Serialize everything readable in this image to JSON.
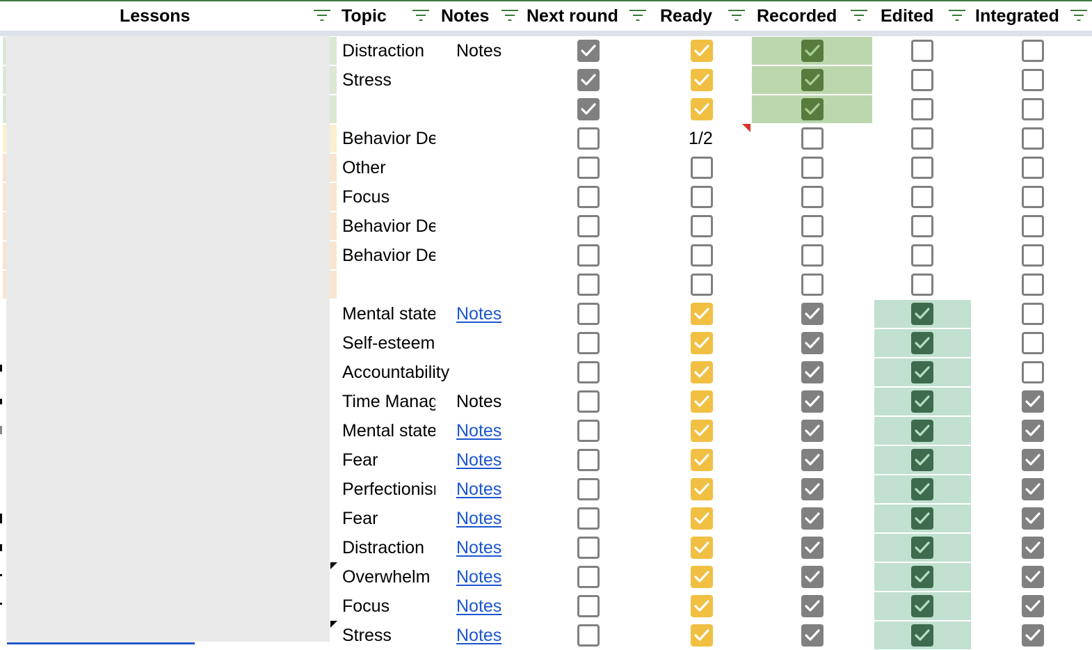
{
  "header": {
    "columns": [
      {
        "key": "lessons",
        "label": "Lessons"
      },
      {
        "key": "topic",
        "label": "Topic"
      },
      {
        "key": "notes",
        "label": "Notes"
      },
      {
        "key": "next_round",
        "label": "Next round"
      },
      {
        "key": "ready",
        "label": "Ready"
      },
      {
        "key": "recorded",
        "label": "Recorded"
      },
      {
        "key": "edited",
        "label": "Edited"
      },
      {
        "key": "integrated",
        "label": "Integrated"
      }
    ],
    "filter_icon": "filter-icon"
  },
  "colors": {
    "accent_green": "#3d7a3d",
    "link_blue": "#1a56cf",
    "checkbox_gray": "#808080",
    "ready_yellow": "#f1bf42",
    "recorded_green_bg": "#bcd7ae",
    "recorded_green_box": "#587c3e",
    "edited_green_bg": "#c1e0d0",
    "edited_green_box": "#3e6b4e",
    "comment_red": "#d0392b"
  },
  "rows": [
    {
      "topic": "Distraction",
      "notes": "Notes",
      "notes_link": false,
      "next_round": true,
      "ready": true,
      "ready_text": null,
      "recorded": true,
      "edited": false,
      "integrated": false,
      "stripe": "#dbe8d4"
    },
    {
      "topic": "Stress",
      "notes": "",
      "notes_link": false,
      "next_round": true,
      "ready": true,
      "ready_text": null,
      "recorded": true,
      "edited": false,
      "integrated": false,
      "stripe": "#dbe8d4"
    },
    {
      "topic": "",
      "notes": "",
      "notes_link": false,
      "next_round": true,
      "ready": true,
      "ready_text": null,
      "recorded": true,
      "edited": false,
      "integrated": false,
      "stripe": "#dbe8d4"
    },
    {
      "topic": "Behavior Design",
      "notes": "",
      "notes_link": false,
      "next_round": false,
      "ready": null,
      "ready_text": "1/2",
      "recorded": false,
      "edited": false,
      "integrated": false,
      "stripe": "#fcefcf"
    },
    {
      "topic": "Other",
      "notes": "",
      "notes_link": false,
      "next_round": false,
      "ready": false,
      "ready_text": null,
      "recorded": false,
      "edited": false,
      "integrated": false,
      "stripe": "#f8e4d1"
    },
    {
      "topic": "Focus",
      "notes": "",
      "notes_link": false,
      "next_round": false,
      "ready": false,
      "ready_text": null,
      "recorded": false,
      "edited": false,
      "integrated": false,
      "stripe": "#f8e4d1"
    },
    {
      "topic": "Behavior Design",
      "notes": "",
      "notes_link": false,
      "next_round": false,
      "ready": false,
      "ready_text": null,
      "recorded": false,
      "edited": false,
      "integrated": false,
      "stripe": "#f8e4d1"
    },
    {
      "topic": "Behavior Design",
      "notes": "",
      "notes_link": false,
      "next_round": false,
      "ready": false,
      "ready_text": null,
      "recorded": false,
      "edited": false,
      "integrated": false,
      "stripe": "#f8e4d1"
    },
    {
      "topic": "",
      "notes": "",
      "notes_link": false,
      "next_round": false,
      "ready": false,
      "ready_text": null,
      "recorded": false,
      "edited": false,
      "integrated": false,
      "stripe": "#f8e4d1"
    },
    {
      "topic": "Mental state",
      "notes": "Notes",
      "notes_link": true,
      "next_round": false,
      "ready": true,
      "ready_text": null,
      "recorded": true,
      "edited": true,
      "integrated": false,
      "stripe": null
    },
    {
      "topic": "Self-esteem",
      "notes": "",
      "notes_link": false,
      "next_round": false,
      "ready": true,
      "ready_text": null,
      "recorded": true,
      "edited": true,
      "integrated": false,
      "stripe": null
    },
    {
      "topic": "Accountability",
      "notes": "",
      "notes_link": false,
      "next_round": false,
      "ready": true,
      "ready_text": null,
      "recorded": true,
      "edited": true,
      "integrated": false,
      "stripe": null
    },
    {
      "topic": "Time Management",
      "notes": "Notes",
      "notes_link": false,
      "next_round": false,
      "ready": true,
      "ready_text": null,
      "recorded": true,
      "edited": true,
      "integrated": true,
      "stripe": null
    },
    {
      "topic": "Mental state",
      "notes": "Notes",
      "notes_link": true,
      "next_round": false,
      "ready": true,
      "ready_text": null,
      "recorded": true,
      "edited": true,
      "integrated": true,
      "stripe": null
    },
    {
      "topic": "Fear",
      "notes": "Notes",
      "notes_link": true,
      "next_round": false,
      "ready": true,
      "ready_text": null,
      "recorded": true,
      "edited": true,
      "integrated": true,
      "stripe": null
    },
    {
      "topic": "Perfectionism",
      "notes": "Notes",
      "notes_link": true,
      "next_round": false,
      "ready": true,
      "ready_text": null,
      "recorded": true,
      "edited": true,
      "integrated": true,
      "stripe": null
    },
    {
      "topic": "Fear",
      "notes": "Notes",
      "notes_link": true,
      "next_round": false,
      "ready": true,
      "ready_text": null,
      "recorded": true,
      "edited": true,
      "integrated": true,
      "stripe": null
    },
    {
      "topic": "Distraction",
      "notes": "Notes",
      "notes_link": true,
      "next_round": false,
      "ready": true,
      "ready_text": null,
      "recorded": true,
      "edited": true,
      "integrated": true,
      "stripe": null
    },
    {
      "topic": "Overwhelm",
      "notes": "Notes",
      "notes_link": true,
      "next_round": false,
      "ready": true,
      "ready_text": null,
      "recorded": true,
      "edited": true,
      "integrated": true,
      "stripe": null
    },
    {
      "topic": "Focus",
      "notes": "Notes",
      "notes_link": true,
      "next_round": false,
      "ready": true,
      "ready_text": null,
      "recorded": true,
      "edited": true,
      "integrated": true,
      "stripe": null
    },
    {
      "topic": "Stress",
      "notes": "Notes",
      "notes_link": true,
      "next_round": false,
      "ready": true,
      "ready_text": null,
      "recorded": true,
      "edited": true,
      "integrated": true,
      "stripe": null
    }
  ]
}
